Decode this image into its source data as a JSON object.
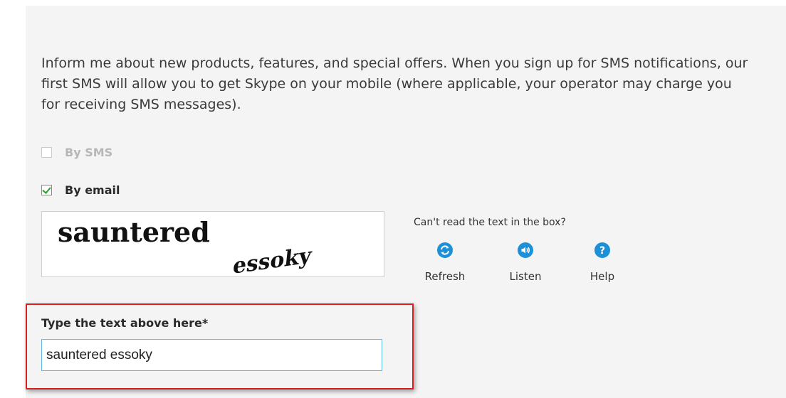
{
  "intro": {
    "text": "Inform me about new products, features, and special offers. When you sign up for SMS notifications, our first SMS will allow you to get Skype on your mobile (where applicable, your operator may charge you for receiving SMS messages)."
  },
  "options": {
    "sms": {
      "label": "By SMS",
      "checked": false,
      "disabled": true
    },
    "email": {
      "label": "By email",
      "checked": true,
      "disabled": false
    }
  },
  "captcha": {
    "word1": "sauntered",
    "word2": "essoky",
    "cant_read": "Can't read the text in the box?",
    "refresh_label": "Refresh",
    "listen_label": "Listen",
    "help_label": "Help",
    "icon_color": "#1e90d8"
  },
  "field": {
    "label": "Type the text above here*",
    "value": "sauntered essoky"
  },
  "colors": {
    "highlight_border": "#d62020",
    "input_border": "#5eb9e6",
    "check_tick": "#2e9e2e"
  }
}
